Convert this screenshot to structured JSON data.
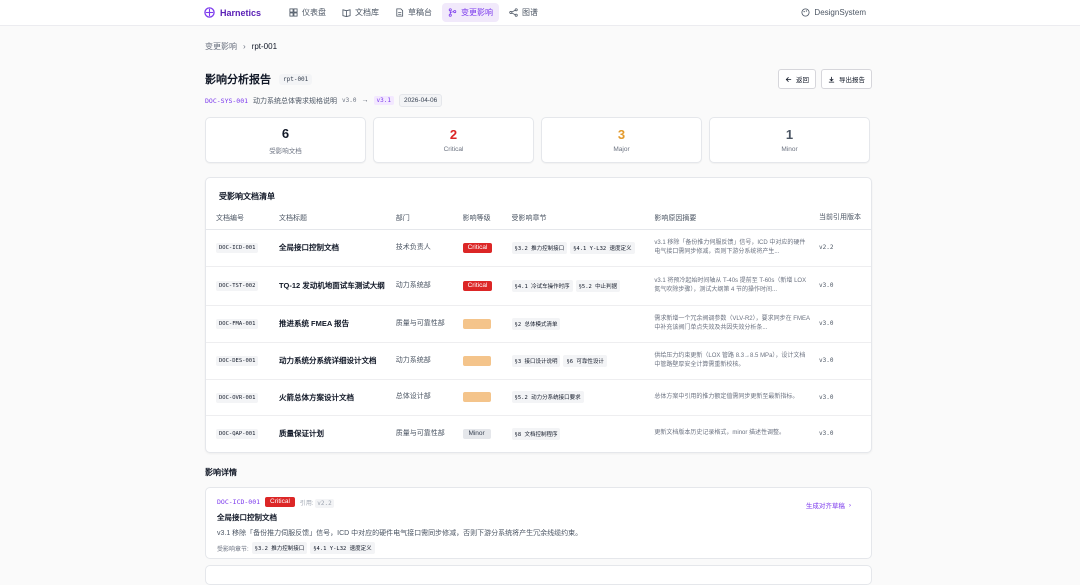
{
  "nav": {
    "brand": "Harnetics",
    "items": [
      {
        "label": "仪表盘",
        "icon": "dashboard-icon"
      },
      {
        "label": "文档库",
        "icon": "book-icon"
      },
      {
        "label": "草稿台",
        "icon": "document-icon"
      },
      {
        "label": "变更影响",
        "icon": "git-branch-icon"
      },
      {
        "label": "图谱",
        "icon": "graph-icon"
      }
    ],
    "design_system": "DesignSystem"
  },
  "breadcrumb": {
    "parent": "变更影响",
    "current": "rpt-001"
  },
  "header": {
    "title": "影响分析报告",
    "report_id": "rpt-001",
    "back_label": "返回",
    "export_label": "导出报告",
    "doc_code": "DOC-SYS-001",
    "doc_name": "动力系统总体需求规格说明",
    "old_version": "v3.0",
    "arrow": "→",
    "new_version": "v3.1",
    "date": "2026-04-06"
  },
  "stats": [
    {
      "value": "6",
      "label": "受影响文档",
      "color": "#111827"
    },
    {
      "value": "2",
      "label": "Critical",
      "color": "#dc2626"
    },
    {
      "value": "3",
      "label": "Major",
      "color": "#e39a2b"
    },
    {
      "value": "1",
      "label": "Minor",
      "color": "#4b5563"
    }
  ],
  "table": {
    "title": "受影响文档清单",
    "columns": [
      "文档编号",
      "文档标题",
      "部门",
      "影响等级",
      "受影响章节",
      "影响原因摘要",
      "当前引用版本"
    ],
    "rows": [
      {
        "code": "DOC-ICD-001",
        "title": "全局接口控制文档",
        "dept": "技术负责人",
        "severity": "Critical",
        "sev_class": "critical",
        "sections": [
          "§3.2 推力控制接口",
          "§4.1 Y-L32 速度定义"
        ],
        "reason": "v3.1 移除「备份推力伺服反馈」信号，ICD 中对应的硬件电气接口需同步修减，否则下游分系统将产生...",
        "ref": "v2.2"
      },
      {
        "code": "DOC-TST-002",
        "title": "TQ-12 发动机地面试车测试大纲",
        "dept": "动力系统部",
        "severity": "Critical",
        "sev_class": "critical",
        "sections": [
          "§4.1 冷试车操作时序",
          "§5.2 中止判据"
        ],
        "reason": "v3.1 将预冷起始时间轴从 T-40s 提前至 T-60s（新增 LOX 氮气吹除步骤），测试大纲第 4 节的操作时间...",
        "ref": "v3.0"
      },
      {
        "code": "DOC-FMA-001",
        "title": "推进系统 FMEA 报告",
        "dept": "质量与可靠性部",
        "severity": "Major",
        "sev_class": "major",
        "sections": [
          "§2 总体模式清单"
        ],
        "reason": "需求新增一个冗余阀调参数（VLV-R2），要求同步在 FMEA 中补充该阀门单点失效及共因失效分析条...",
        "ref": "v3.0"
      },
      {
        "code": "DOC-DES-001",
        "title": "动力系统分系统详细设计文档",
        "dept": "动力系统部",
        "severity": "Major",
        "sev_class": "major",
        "sections": [
          "§3 接口设计说明",
          "§6 可靠性设计"
        ],
        "reason": "供给压力约束更新（LOX 管路 8.3→8.5 MPa），设计文档中管路壁厚安全计算需重新校核。",
        "ref": "v3.0"
      },
      {
        "code": "DOC-OVR-001",
        "title": "火箭总体方案设计文档",
        "dept": "总体设计部",
        "severity": "Major",
        "sev_class": "major",
        "sections": [
          "§5.2 动力分系统接口要求"
        ],
        "reason": "总体方案中引用的推力额定值需同步更新至最新指标。",
        "ref": "v3.0"
      },
      {
        "code": "DOC-QAP-001",
        "title": "质量保证计划",
        "dept": "质量与可靠性部",
        "severity": "Minor",
        "sev_class": "minor",
        "sections": [
          "§8 文档控制程序"
        ],
        "reason": "更新文档版本历史记录格式，minor 描述性调整。",
        "ref": "v3.0"
      }
    ]
  },
  "detail": {
    "heading": "影响详情",
    "code": "DOC-ICD-001",
    "severity": "Critical",
    "ref_label": "引用:",
    "ref_version": "v2.2",
    "generate_label": "生成对齐草稿",
    "title": "全局接口控制文档",
    "desc": "v3.1 移除「备份推力伺服反馈」信号，ICD 中对应的硬件电气接口需同步修减，否则下游分系统将产生冗余线缆约束。",
    "sections_label": "受影响章节:",
    "sections": [
      "§3.2 推力控制接口",
      "§4.1 Y-L32 速度定义"
    ]
  }
}
